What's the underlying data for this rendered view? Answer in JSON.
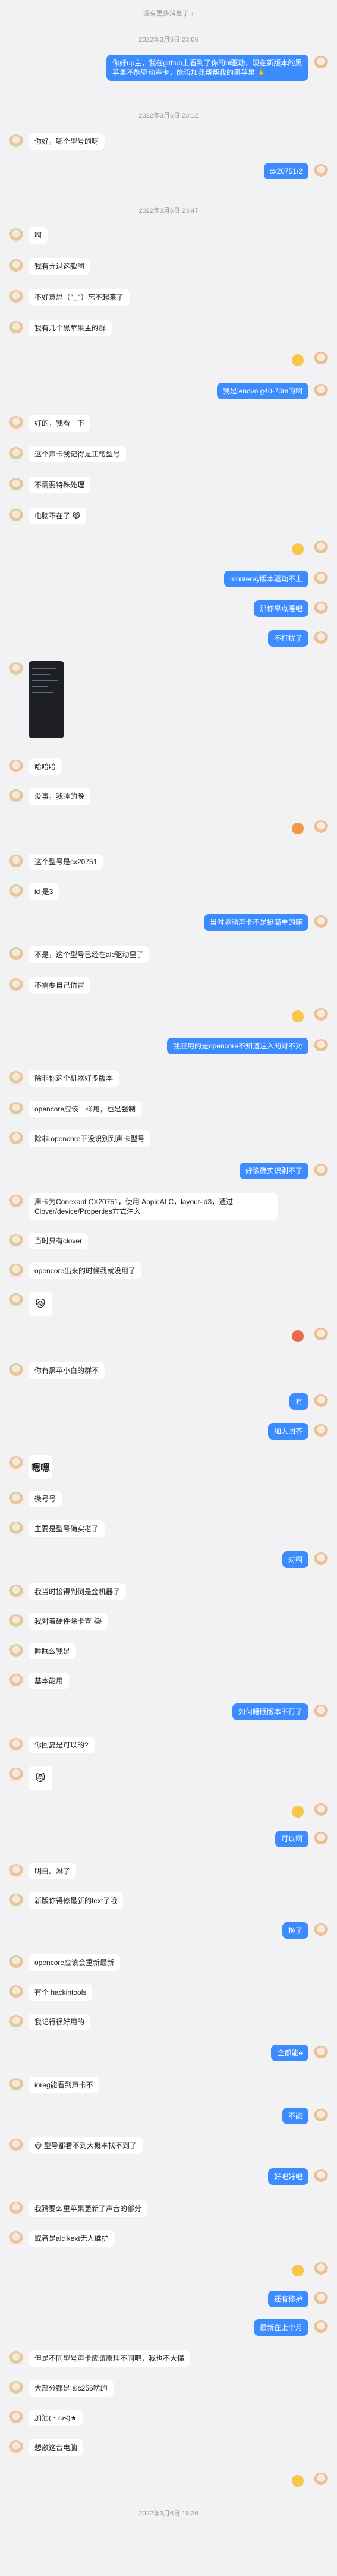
{
  "header": {
    "top_notice": "没有更多消息了 ↓"
  },
  "timestamps": [
    "2022年3月6日 23:06",
    "2022年3月6日 23:12",
    "2022年3月6日 23:47",
    "2022年3月6日 18:36"
  ],
  "messages": {
    "m1": "你好up主，我在github上看到了你的bl驱动，现在新版本的黑苹果不能驱动声卡，能否加我帮帮我的黑苹果 🙏",
    "m2": "你好，哪个型号的呀",
    "m3": "cx20751/2",
    "m4": "啊",
    "m5": "我有弄过这款啊",
    "m6": "不好意思（^_^）忘不起来了",
    "m7": "我有几个黑苹果主的群",
    "m8": "我是lenovo g40-70m的啊",
    "m9": "好的，我看一下",
    "m10": "这个声卡我记得是正常型号",
    "m11": "不需要特殊处理",
    "m12": "电脑不在了 😹",
    "m13": "monterey版本驱动不上",
    "m14": "那你早点睡吧",
    "m15": "不打扰了",
    "m16": "哈哈哈",
    "m17": "没事，我睡的晚",
    "m18": "这个型号是cx20751",
    "m19": "id 是3",
    "m20": "当时驱动声卡不是挺简单的嘛",
    "m21": "不是，这个型号已经在alc驱动里了",
    "m22": "不需要自己仿冒",
    "m23": "我应用的是opencore不知道注入的对不对",
    "m24": "除非你这个机器好多版本",
    "m25": "opencore应该一样用，也是强制",
    "m26": "除非 opencore下没识别到声卡型号",
    "m27": "好像确实识别不了",
    "m28": "声卡为Conexant CX20751，使用 AppleALC，layout-id3，通过Clover/device/Properties方式注入",
    "m29": "当时只有clover",
    "m30": "opencore出来的时候我就没用了",
    "m31": "你有黑苹小白的群不",
    "m32": "有",
    "m33": "加人回答",
    "m34": "嗯嗯",
    "m35": "微号号",
    "m36": "主要是型号确实老了",
    "m37": "对啊",
    "m38": "我当时接得到倒是金机器了",
    "m39": "我对着硬件除卡查 😹",
    "m40": "睡眠么我是",
    "m41": "基本能用",
    "m42": "如何睡眠版本不行了",
    "m43": "你回复是可以的?",
    "m44": "可以啊",
    "m45": "明白。淋了",
    "m46": "新版你得修最新的text了哦",
    "m47": "换了",
    "m48": "opencore应该会重新最新",
    "m49": "有个 hackintools",
    "m50": "我记得很好用的",
    "m51": "全都能e",
    "m52": "ioreg能看到声卡不",
    "m53": "不能",
    "m54": "😅 型号都看不到大概率找不到了",
    "m55": "好吧好吧",
    "m56": "我猜要么重苹果更新了声音的部分",
    "m57": "或者是alc kext无人维护",
    "m58": "还有修护",
    "m59": "最新在上个月",
    "m60": "但是不同型号声卡应该原理不同吧，我也不大懂",
    "m61": "大部分都是 alc256啥的",
    "m62": "加油(・ω<)★",
    "m63": "想散这台电脑"
  },
  "colors": {
    "accent": "#3c8cff",
    "bg": "#f2f2f4",
    "left_bubble": "#ffffff"
  }
}
